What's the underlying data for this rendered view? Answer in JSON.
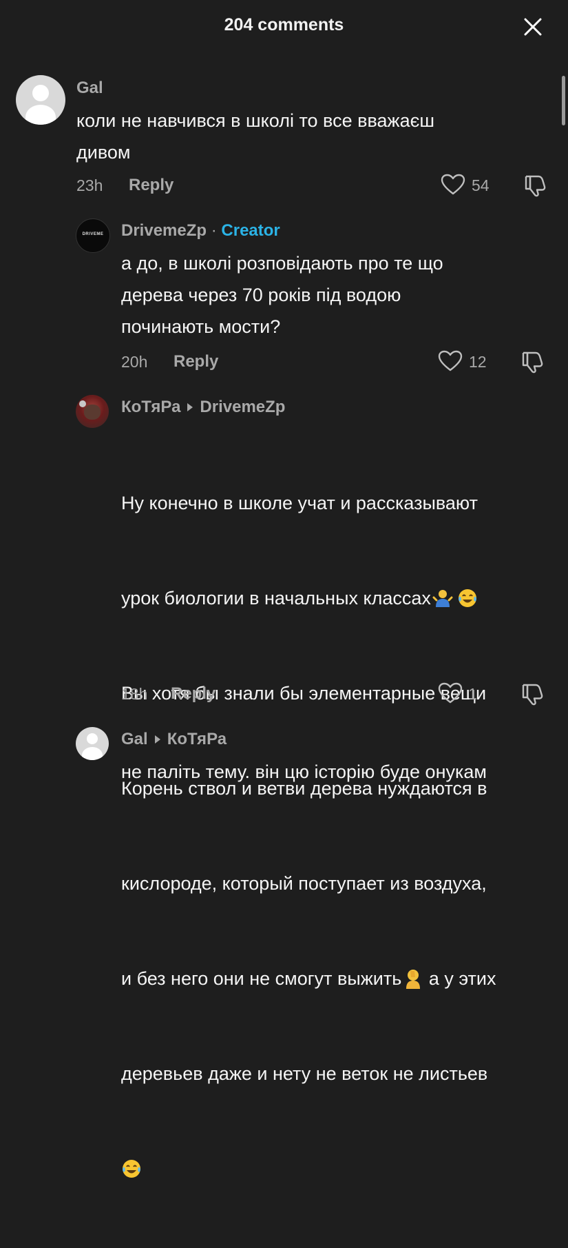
{
  "header": {
    "title": "204 comments",
    "close_icon": "close-icon"
  },
  "comments": [
    {
      "username": "Gal",
      "text": "коли не навчився в школі то все вважаєш\nдивом",
      "time": "23h",
      "reply_label": "Reply",
      "likes": "54"
    },
    {
      "username": "DrivemeZp",
      "separator": "·",
      "badge": "Creator",
      "avatar_text": "DRIVEME",
      "text": "а до, в школі розповідають про те що\nдерева через 70 років під водою\nпочинають мости?",
      "time": "20h",
      "reply_label": "Reply",
      "likes": "12"
    },
    {
      "username": "КоТяРа",
      "reply_to": "DrivemeZp",
      "text_lines": [
        "Ну конечно в школе учат и рассказывают",
        "урок биологии в начальных классах",
        "Вы хотя бы знали бы элементарные вещи",
        "Корень ствол и ветви дерева нуждаются в",
        "кислороде, который поступает из воздуха,",
        "и без него они не смогут выжить",
        "а у этих",
        "деревьев даже и нету не веток не листьев"
      ],
      "time": "18h",
      "reply_label": "Reply",
      "likes": "1"
    },
    {
      "username": "Gal",
      "reply_to": "КоТяРа",
      "text": "не паліть тему. він цю історію буде онукам"
    }
  ],
  "colors": {
    "background": "#1e1e1e",
    "creator_badge": "#2bb3e6",
    "secondary_text": "#a9a9a9"
  }
}
